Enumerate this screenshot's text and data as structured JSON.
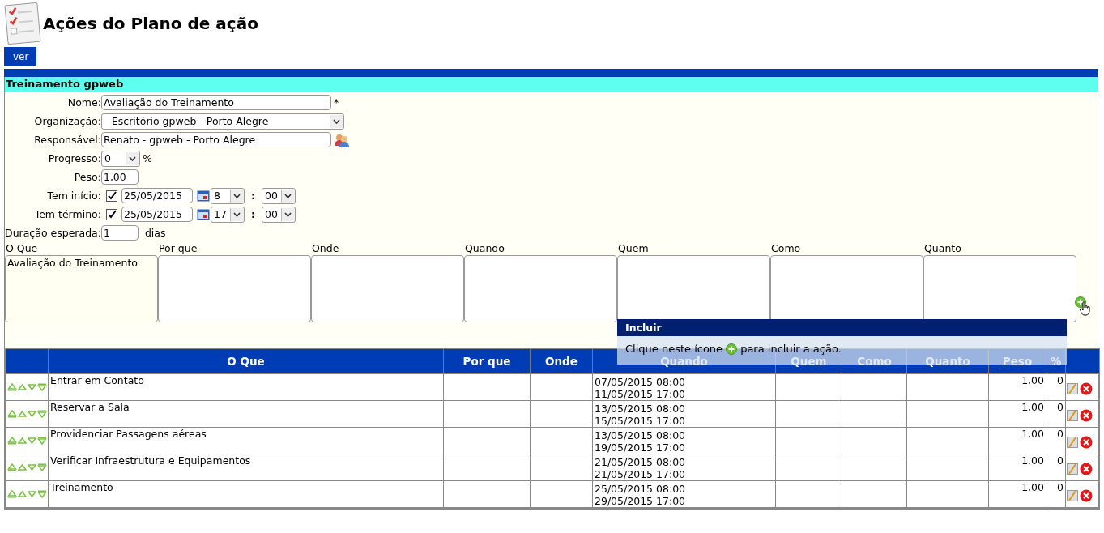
{
  "page": {
    "title": "Ações do Plano de ação"
  },
  "toolbar": {
    "buttons": [
      "ver"
    ]
  },
  "form": {
    "title": "Treinamento gpweb",
    "fields": [
      {
        "kind": "text",
        "label": "Nome:",
        "value": "Avaliação do Treinamento",
        "suffix": "*"
      },
      {
        "kind": "select",
        "label": "Organização:",
        "value": "Escritório gpweb - Porto Alegre"
      },
      {
        "kind": "person",
        "label": "Responsável:",
        "value": "Renato - gpweb - Porto Alegre"
      },
      {
        "kind": "select",
        "label": "Progresso:",
        "value": "0",
        "suffix": "%"
      },
      {
        "kind": "text",
        "label": "Peso:",
        "value": "1,00"
      },
      {
        "kind": "datetime",
        "label": "Tem início:",
        "checked": true,
        "date": "25/05/2015",
        "hour": "8",
        "separator": ":",
        "minute": "00"
      },
      {
        "kind": "datetime",
        "label": "Tem término:",
        "checked": true,
        "date": "25/05/2015",
        "hour": "17",
        "separator": ":",
        "minute": "00"
      },
      {
        "kind": "text",
        "label": "Duração esperada:",
        "value": "1",
        "suffix": "dias"
      }
    ],
    "details": [
      {
        "label": "O Que",
        "value": "Avaliação do Treinamento"
      },
      {
        "label": "Por que"
      },
      {
        "label": "Onde"
      },
      {
        "label": "Quando"
      },
      {
        "label": "Quem"
      },
      {
        "label": "Como"
      },
      {
        "label": "Quanto"
      }
    ]
  },
  "table": {
    "columns": [
      "O Que",
      "Por que",
      "Onde",
      "Quando",
      "Quem",
      "Como",
      "Quanto",
      "Peso",
      "%"
    ],
    "rows": [
      {
        "o_que": "Entrar em Contato",
        "start": "07/05/2015 08:00",
        "end": "11/05/2015 17:00",
        "peso": "1,00",
        "percent": "0"
      },
      {
        "o_que": "Reservar a Sala",
        "start": "13/05/2015 08:00",
        "end": "15/05/2015 17:00",
        "peso": "1,00",
        "percent": "0"
      },
      {
        "o_que": "Providenciar Passagens aéreas",
        "start": "13/05/2015 08:00",
        "end": "19/05/2015 17:00",
        "peso": "1,00",
        "percent": "0"
      },
      {
        "o_que": "Verificar Infraestrutura e Equipamentos",
        "start": "21/05/2015 08:00",
        "end": "21/05/2015 17:00",
        "peso": "1,00",
        "percent": "0"
      },
      {
        "o_que": "Treinamento",
        "start": "25/05/2015 08:00",
        "end": "29/05/2015 17:00",
        "peso": "1,00",
        "percent": "0"
      }
    ]
  },
  "tooltip": {
    "title": "Incluir",
    "text_before": "Clique neste ícone",
    "text_after": "para incluir a ação."
  }
}
